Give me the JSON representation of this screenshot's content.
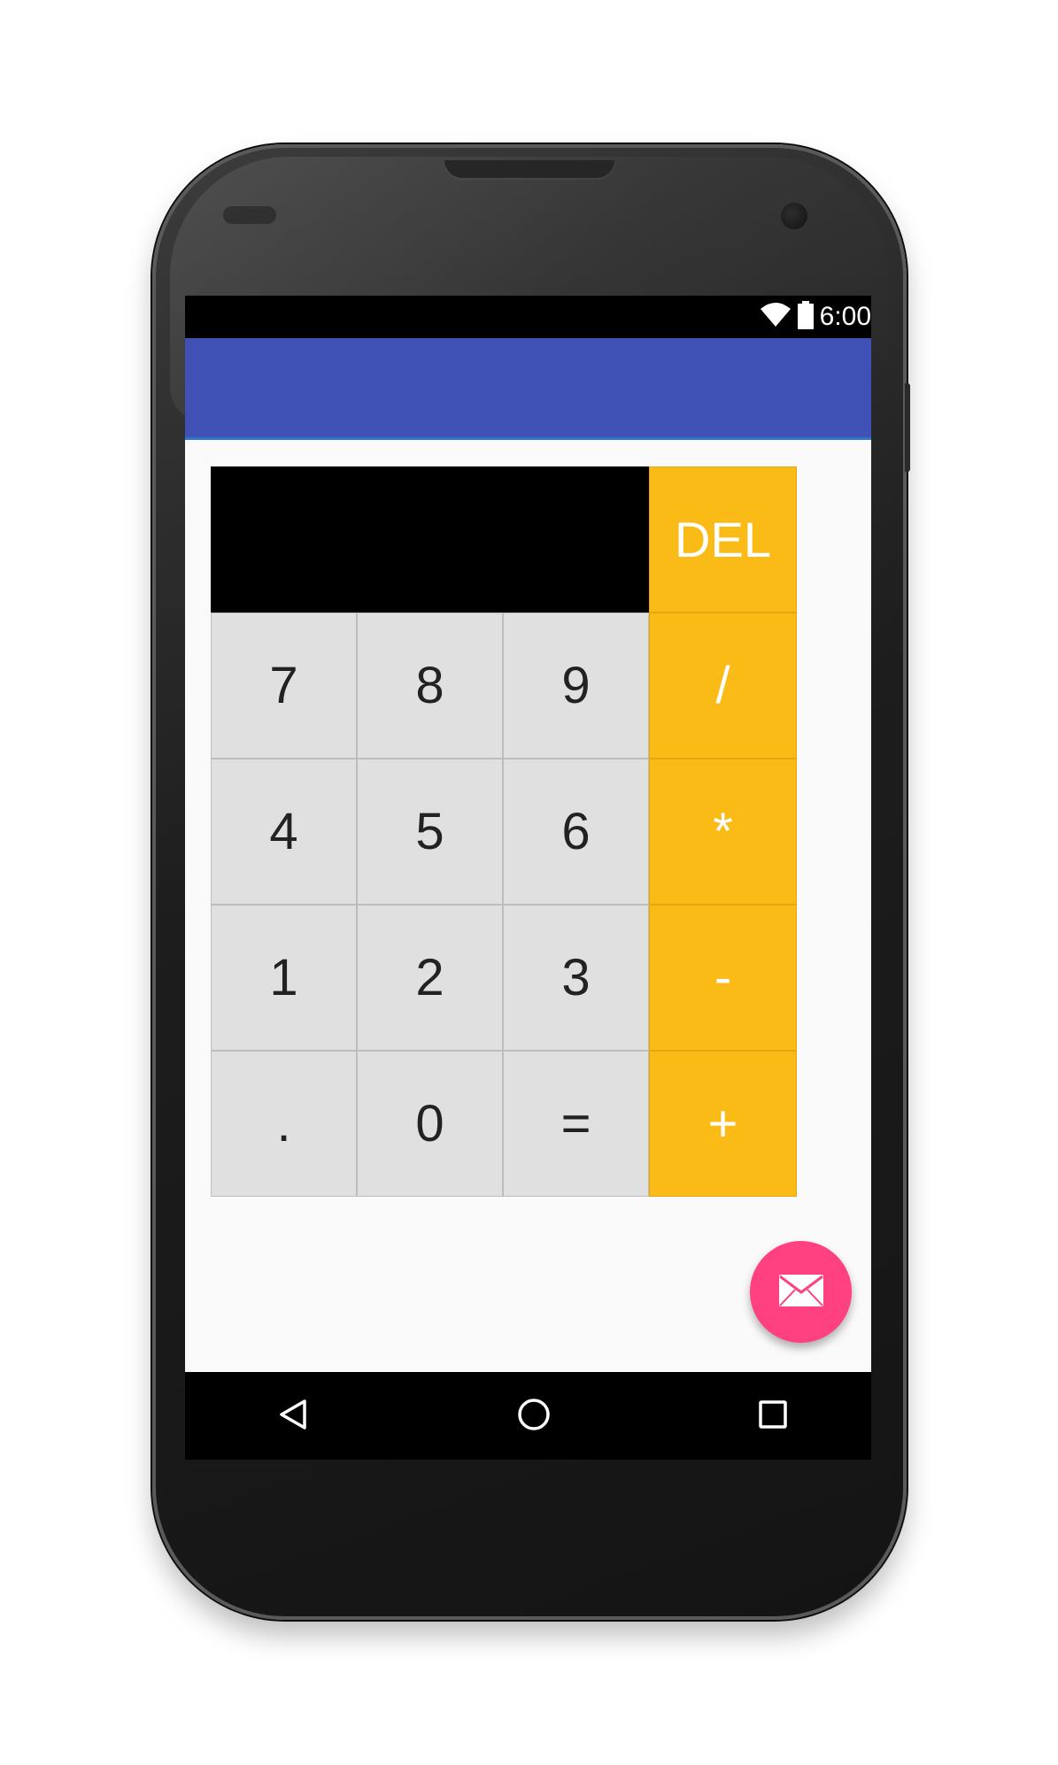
{
  "status_bar": {
    "time": "6:00",
    "icons": [
      "wifi-icon",
      "battery-icon"
    ]
  },
  "app_bar": {
    "color": "#3f51b5"
  },
  "calculator": {
    "display_value": "",
    "del_label": "DEL",
    "rows": [
      [
        "7",
        "8",
        "9",
        "/"
      ],
      [
        "4",
        "5",
        "6",
        "*"
      ],
      [
        "1",
        "2",
        "3",
        "-"
      ],
      [
        ".",
        "0",
        "=",
        "+"
      ]
    ],
    "colors": {
      "display_bg": "#000000",
      "digit_bg": "#e0e0e0",
      "operator_bg": "#fbbb17"
    }
  },
  "fab": {
    "icon": "mail-icon",
    "color": "#ff4081"
  },
  "nav_bar": {
    "icons": [
      "back-icon",
      "home-icon",
      "recents-icon"
    ]
  }
}
